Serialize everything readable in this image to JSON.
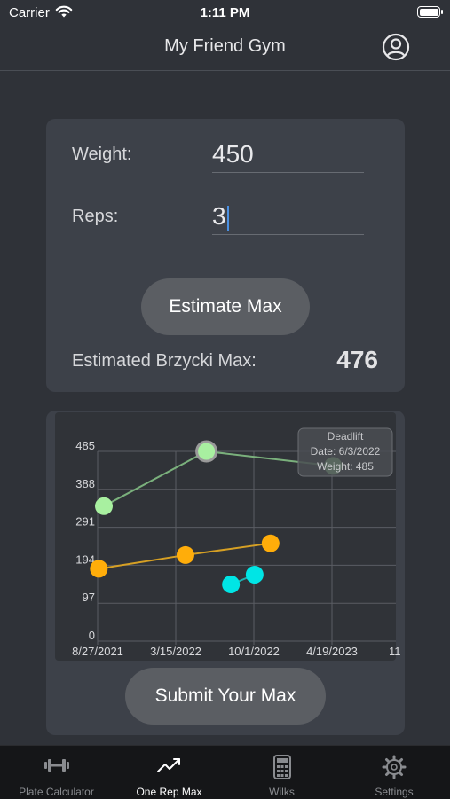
{
  "status_bar": {
    "carrier": "Carrier",
    "time": "1:11 PM"
  },
  "nav": {
    "title": "My Friend Gym",
    "profile_icon": "person-circle-icon"
  },
  "form": {
    "weight_label": "Weight:",
    "weight_value": "450",
    "reps_label": "Reps:",
    "reps_value": "3",
    "estimate_button": "Estimate Max",
    "result_label": "Estimated Brzycki Max:",
    "result_value": "476"
  },
  "chart_data": {
    "type": "line",
    "x_tick_labels": [
      "8/27/2021",
      "3/15/2022",
      "10/1/2022",
      "4/19/2023",
      "11"
    ],
    "y_tick_labels": [
      "0",
      "97",
      "194",
      "291",
      "388",
      "485"
    ],
    "ylim": [
      0,
      485
    ],
    "grid": true,
    "series": [
      {
        "name": "Deadlift",
        "color": "#a8f0a0",
        "line_color": "#7ab07c",
        "points": [
          {
            "x": "9/12/2021",
            "y": 345
          },
          {
            "x": "6/3/2022",
            "y": 485
          },
          {
            "x": "4/25/2023",
            "y": 448
          }
        ]
      },
      {
        "color": "#ffad0a",
        "line_color": "#d6a024",
        "points": [
          {
            "x": "8/30/2021",
            "y": 185
          },
          {
            "x": "4/10/2022",
            "y": 220
          },
          {
            "x": "11/15/2022",
            "y": 250
          }
        ]
      },
      {
        "color": "#00e5e5",
        "line_color": "#20b0b0",
        "points": [
          {
            "x": "8/5/2022",
            "y": 145
          },
          {
            "x": "10/5/2022",
            "y": 170
          }
        ]
      }
    ],
    "tooltip": {
      "title": "Deadlift",
      "date_line": "Date: 6/3/2022",
      "weight_line": "Weight: 485"
    }
  },
  "submit_button": "Submit Your Max",
  "tabs": [
    {
      "label": "Plate Calculator",
      "icon": "dumbbell-icon",
      "active": false
    },
    {
      "label": "One Rep Max",
      "icon": "trend-chart-icon",
      "active": true
    },
    {
      "label": "Wilks",
      "icon": "calculator-icon",
      "active": false
    },
    {
      "label": "Settings",
      "icon": "gear-icon",
      "active": false
    }
  ]
}
